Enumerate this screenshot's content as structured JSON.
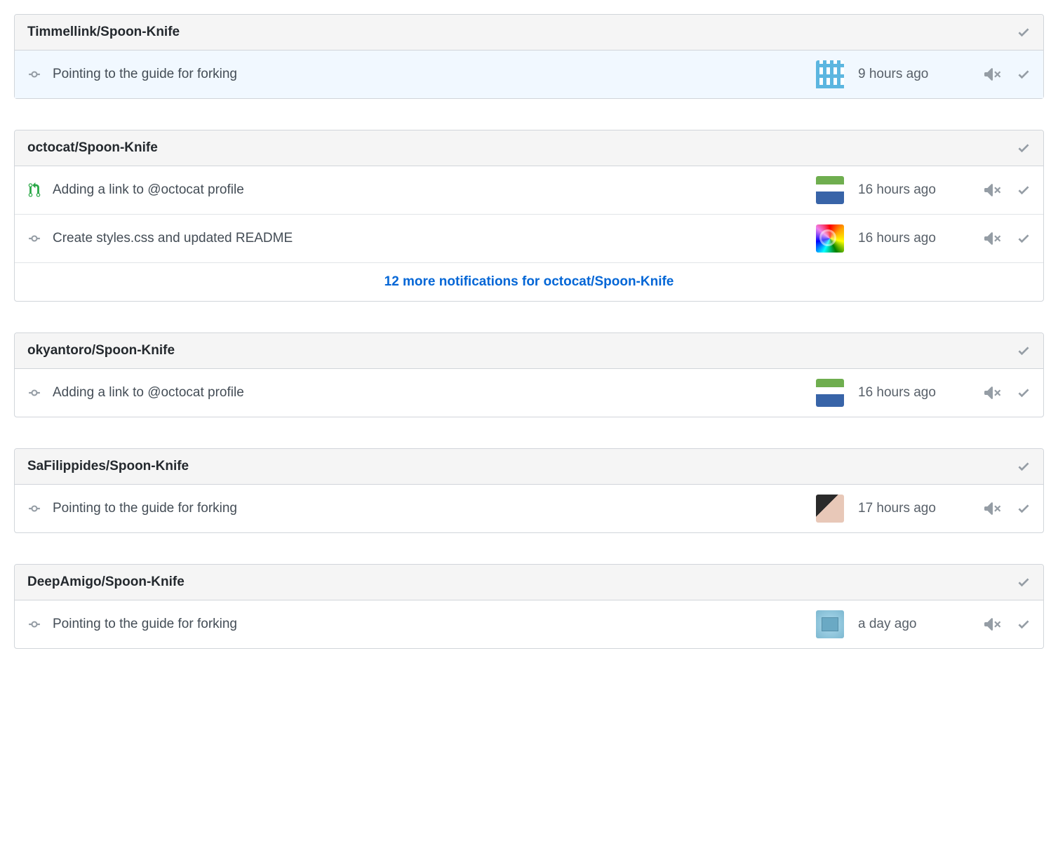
{
  "groups": [
    {
      "repo": "Timmellink/Spoon-Knife",
      "items": [
        {
          "type": "commit",
          "title": "Pointing to the guide for forking",
          "time": "9 hours ago",
          "avatar": "a",
          "unread": true
        }
      ],
      "more": null
    },
    {
      "repo": "octocat/Spoon-Knife",
      "items": [
        {
          "type": "pr",
          "title": "Adding a link to @octocat profile",
          "time": "16 hours ago",
          "avatar": "b",
          "unread": false
        },
        {
          "type": "commit",
          "title": "Create styles.css and updated README",
          "time": "16 hours ago",
          "avatar": "c",
          "unread": false
        }
      ],
      "more": "12 more notifications for octocat/Spoon-Knife"
    },
    {
      "repo": "okyantoro/Spoon-Knife",
      "items": [
        {
          "type": "commit",
          "title": "Adding a link to @octocat profile",
          "time": "16 hours ago",
          "avatar": "b",
          "unread": false
        }
      ],
      "more": null
    },
    {
      "repo": "SaFilippides/Spoon-Knife",
      "items": [
        {
          "type": "commit",
          "title": "Pointing to the guide for forking",
          "time": "17 hours ago",
          "avatar": "d",
          "unread": false
        }
      ],
      "more": null
    },
    {
      "repo": "DeepAmigo/Spoon-Knife",
      "items": [
        {
          "type": "commit",
          "title": "Pointing to the guide for forking",
          "time": "a day ago",
          "avatar": "e",
          "unread": false
        }
      ],
      "more": null
    }
  ]
}
